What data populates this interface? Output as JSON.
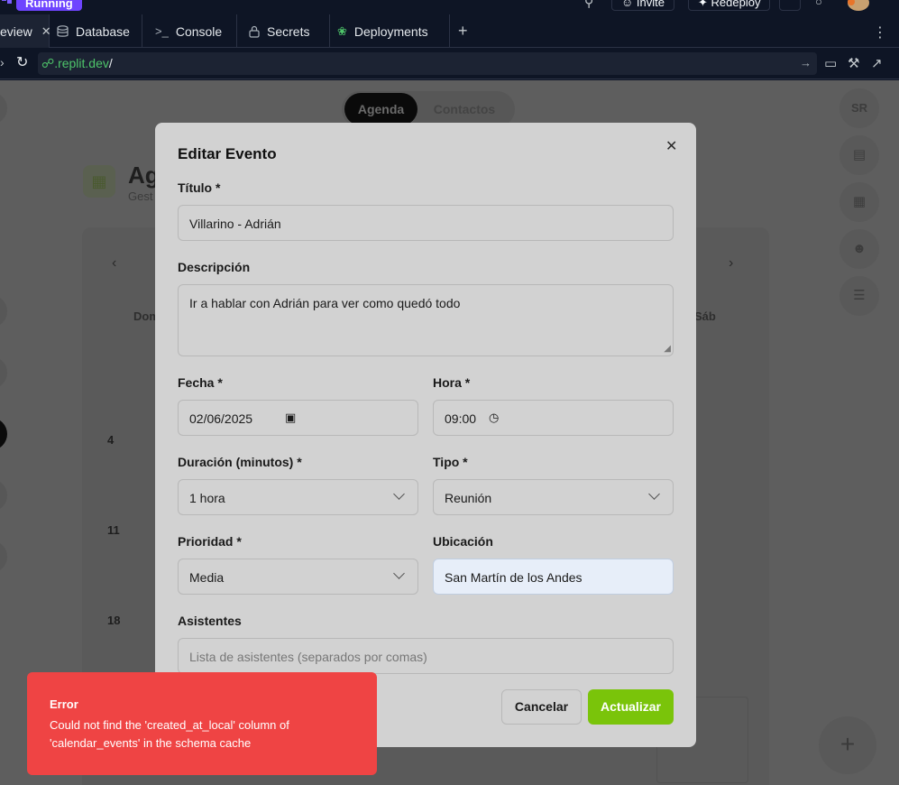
{
  "ide": {
    "run_status": "Running",
    "top_buttons": {
      "invite": "Invite",
      "redeploy": "Redeploy"
    },
    "tabs": [
      {
        "label": "eview",
        "icon": "webview-icon",
        "active": true
      },
      {
        "label": "Database",
        "icon": "database-icon"
      },
      {
        "label": "Console",
        "icon": "console-icon"
      },
      {
        "label": "Secrets",
        "icon": "lock-icon"
      },
      {
        "label": "Deployments",
        "icon": "deploy-icon"
      }
    ],
    "url": {
      "host": ".replit.dev",
      "path": "/"
    }
  },
  "app_background": {
    "segment": {
      "active": "Agenda",
      "inactive": "Contactos"
    },
    "page_title": "Ag",
    "page_subtitle": "Gest",
    "days": {
      "sun": "Dom",
      "sat": "Sáb"
    },
    "week_numbers": [
      "4",
      "11",
      "18"
    ],
    "rail_initials": "SR"
  },
  "modal": {
    "title": "Editar Evento",
    "fields": {
      "titulo": {
        "label": "Título *",
        "value": "Villarino - Adrián"
      },
      "descripcion": {
        "label": "Descripción",
        "value": "Ir a hablar con Adrián para ver como quedó todo"
      },
      "fecha": {
        "label": "Fecha *",
        "value": "02/06/2025"
      },
      "hora": {
        "label": "Hora *",
        "value": "09:00"
      },
      "duracion": {
        "label": "Duración (minutos) *",
        "value": "1 hora"
      },
      "tipo": {
        "label": "Tipo *",
        "value": "Reunión"
      },
      "prioridad": {
        "label": "Prioridad *",
        "value": "Media"
      },
      "ubicacion": {
        "label": "Ubicación",
        "value": "San Martín de los Andes"
      },
      "asistentes": {
        "label": "Asistentes",
        "placeholder": "Lista de asistentes (separados por comas)"
      }
    },
    "buttons": {
      "cancel": "Cancelar",
      "submit": "Actualizar"
    }
  },
  "toast": {
    "title": "Error",
    "message": "Could not find the 'created_at_local' column of 'calendar_events' in the schema cache"
  },
  "colors": {
    "accent_green": "#7ac40a",
    "error_red": "#ef4444",
    "running_purple": "#6e44ff",
    "ide_bg": "#0e1525"
  }
}
